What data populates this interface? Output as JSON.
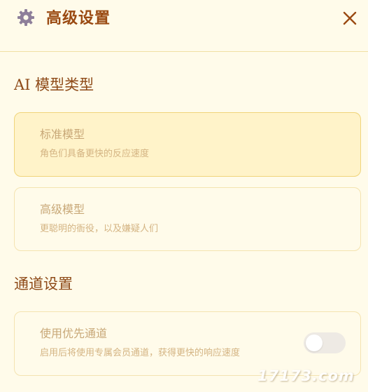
{
  "header": {
    "title": "高级设置",
    "icon": "gear-icon",
    "close_icon": "close-icon"
  },
  "sections": [
    {
      "title": "AI 模型类型",
      "options": [
        {
          "label": "标准模型",
          "description": "角色们具备更快的反应速度",
          "selected": true
        },
        {
          "label": "高级模型",
          "description": "更聪明的衙役，以及嫌疑人们",
          "selected": false
        }
      ]
    },
    {
      "title": "通道设置",
      "options": [
        {
          "label": "使用优先通道",
          "description": "启用后将使用专属会员通道，获得更快的响应速度",
          "toggle_on": false
        }
      ]
    }
  ],
  "watermark": "17173.com",
  "colors": {
    "background": "#fffbea",
    "title": "#9a4a12",
    "gear": "#8e7f9a",
    "selected_card": "#fff3c9"
  }
}
